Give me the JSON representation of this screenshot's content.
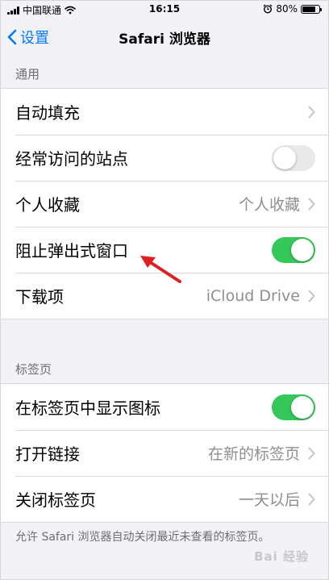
{
  "status_bar": {
    "carrier": "中国联通",
    "time": "16:15",
    "battery_text": "80%",
    "battery_level": 0.8,
    "icons": [
      "signal-icon",
      "wifi-icon",
      "alarm-icon",
      "battery-icon"
    ]
  },
  "nav": {
    "back_label": "设置",
    "title": "Safari 浏览器"
  },
  "general": {
    "header": "通用",
    "autofill": "自动填充",
    "frequent_sites": "经常访问的站点",
    "frequent_sites_on": false,
    "favorites": "个人收藏",
    "favorites_value": "个人收藏",
    "block_popups": "阻止弹出式窗口",
    "block_popups_on": true,
    "downloads": "下载项",
    "downloads_value": "iCloud Drive"
  },
  "tabs": {
    "header": "标签页",
    "show_icons": "在标签页中显示图标",
    "show_icons_on": true,
    "open_links": "打开链接",
    "open_links_value": "在新的标签页",
    "close_tabs": "关闭标签页",
    "close_tabs_value": "一天以后"
  },
  "footer_note": "允许 Safari 浏览器自动关闭最近未查看的标签页。",
  "watermark": "Bai 经验",
  "colors": {
    "accent": "#007aff",
    "toggle_on": "#34c759",
    "annotation_arrow": "#e02020"
  }
}
